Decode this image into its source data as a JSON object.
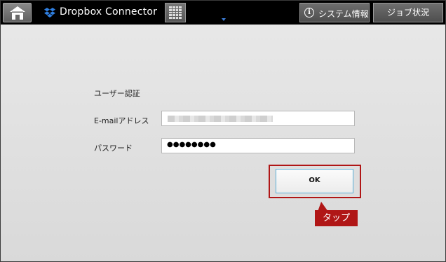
{
  "topbar": {
    "home_icon": "home-icon",
    "app_icon": "dropbox-icon",
    "app_title": "Dropbox Connector",
    "keyboard_icon": "keyboard-icon",
    "system_info_icon": "info-icon",
    "system_info_label": "システム情報",
    "job_status_label": "ジョブ状況"
  },
  "form": {
    "title": "ユーザー認証",
    "email_label": "E-mailアドレス",
    "password_label": "パスワード",
    "password_value": "●●●●●●●●",
    "ok_label": "OK"
  },
  "annotation": {
    "callout_label": "タップ",
    "color": "#b01616"
  },
  "colors": {
    "topbar_bg": "#000000",
    "accent": "#5ab0d8"
  }
}
